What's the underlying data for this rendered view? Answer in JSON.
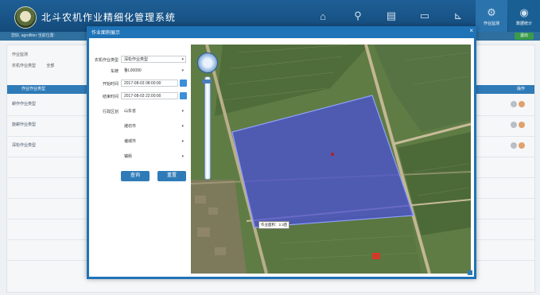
{
  "app": {
    "title": "北斗农机作业精细化管理系统"
  },
  "nav": {
    "icons": [
      "home-icon",
      "location-pin-icon",
      "document-icon",
      "book-icon",
      "chart-icon",
      "gear-icon",
      "gamepad-icon"
    ],
    "active_index": 5,
    "active_labels": [
      "作业监测",
      "数据统计"
    ]
  },
  "subbar": {
    "text": "您好, agrofliter   当前位置:",
    "exit_label": "退出"
  },
  "background": {
    "section_title": "作业监测",
    "filter_label": "农机作业类型",
    "filter_value": "全部",
    "table_header_left": "作业作业类型",
    "table_header_right": "操作",
    "rows": [
      "耕作作业类型",
      "旋耕作业类型",
      "深松作业类型"
    ]
  },
  "modal": {
    "title": "作业面积展示",
    "close_symbol": "×",
    "form": {
      "machine_type": {
        "label": "农机作业类型",
        "value": "深松作业类型"
      },
      "plate": {
        "label": "车牌",
        "value": "鲁L00090"
      },
      "start_time": {
        "label": "开始时间",
        "value": "2017-08-03 08:00:00"
      },
      "end_time": {
        "label": "结束时间",
        "value": "2017-08-03 22:00:00"
      },
      "region": {
        "label": "行政区划",
        "value": "山东省"
      },
      "city": {
        "value": "潍坊市"
      },
      "county": {
        "value": "诸城市"
      },
      "town": {
        "value": "镇街"
      },
      "query_label": "查询",
      "reset_label": "重置"
    },
    "map": {
      "field_label": "作业面积：2.3亩",
      "watermark": "",
      "scale": ""
    }
  }
}
